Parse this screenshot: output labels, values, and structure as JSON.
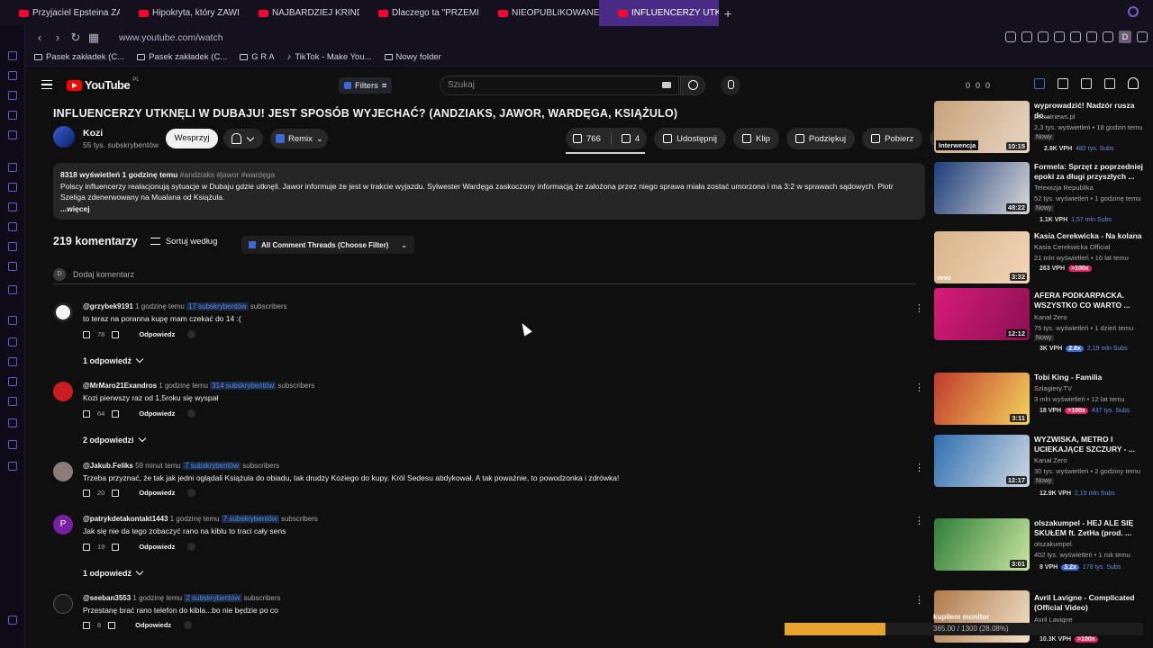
{
  "browser": {
    "tabs": [
      {
        "label": "Przyjaciel Epsteina ZATRZ"
      },
      {
        "label": "Hipokryta, który ZAWIÓD"
      },
      {
        "label": "NAJBARDZIEJ KRINDŻOW"
      },
      {
        "label": "Dlaczego ta \"PRZEMIŁA\""
      },
      {
        "label": "NIEOPUBLIKOWANE MATE"
      },
      {
        "label": "INFLUENCERZY UTKNĘLI"
      }
    ],
    "url": "www.youtube.com/watch",
    "bookmarks": [
      "Pasek zakładek (C...",
      "Pasek zakładek (C...",
      "G R A",
      "TikTok - Make You...",
      "Nowy folder"
    ],
    "profile_initial": "D"
  },
  "header": {
    "logo": "YouTube",
    "logo_country": "PL",
    "filters_label": "Filters",
    "search_placeholder": "Szukaj",
    "stats": [
      "0",
      "0",
      "0"
    ]
  },
  "video": {
    "title": "INFLUENCERZY UTKNĘLI W DUBAJU! JEST SPOSÓB WYJECHAĆ? (ANDZIAKS, JAWOR, WARDĘGA, KSIĄŻULO)",
    "channel": "Kozi",
    "subscribers": "55 tys. subskrybentów",
    "support_label": "Wesprzyj",
    "remix_label": "Remix",
    "likes": "766",
    "dislikes": "4",
    "share_label": "Udostępnij",
    "clip_label": "Klip",
    "thanks_label": "Podziękuj",
    "download_label": "Pobierz"
  },
  "description": {
    "meta": "8318 wyświetleń  1 godzinę temu",
    "tags": "#andziaks #jawor #wardęga",
    "text": "Polscy influencerzy realacjonują sytuacje w Dubaju gdzie utknęli. Jawor informuje że jest w trakcie wyjazdu. Sylwester Wardęga zaskoczony informacją że założona przez niego sprawa miała zostać umorzona i ma 3:2 w sprawach sądowych. Piotr Szeliga zdenerwowany na Mualana od Książula.",
    "more": "...więcej"
  },
  "comments_section": {
    "count": "219 komentarzy",
    "sort_label": "Sortuj według",
    "filter_label": "All Comment Threads (Choose Filter)",
    "add_avatar": "D",
    "add_placeholder": "Dodaj komentarz",
    "reply_label": "Odpowiedz",
    "comments": [
      {
        "author": "@grzybek9191",
        "time": "1 godzinę temu",
        "subs": "17 subskrybentów",
        "subs_suffix": "subscribers",
        "text": "to teraz na poranna kupę mam czekać do 14 :(",
        "likes": "78",
        "replies": "1 odpowiedź",
        "avatar_color": "#ffffff"
      },
      {
        "author": "@MrMaro21Exandros",
        "time": "1 godzinę temu",
        "subs": "314 subskrybentów",
        "subs_suffix": "subscribers",
        "text": "Kozi pierwszy raz od 1,5roku się wyspał",
        "likes": "64",
        "replies": "2 odpowiedzi",
        "avatar_color": "#c81e1e"
      },
      {
        "author": "@Jakub.Feliks",
        "time": "59 minut temu",
        "subs": "7 subskrybentów",
        "subs_suffix": "subscribers",
        "text": "Trzeba przyznać, że tak jak jedni oglądali Książula do obiadu, tak drudzy Koziego do kupy. Król Sedesu abdykował. A tak poważnie, to powodzonka i zdrówka!",
        "likes": "20",
        "replies": "",
        "avatar_color": "#8a7c78"
      },
      {
        "author": "@patrykdetakontakt1443",
        "time": "1 godzinę temu",
        "subs": "7 subskrybentów",
        "subs_suffix": "subscribers",
        "text": "Jak się nie da tego zobaczyć rano na kiblu to traci cały sens",
        "likes": "19",
        "replies": "1 odpowiedź",
        "avatar_color": "#7b1fa2",
        "avatar_letter": "P"
      },
      {
        "author": "@seeban3553",
        "time": "1 godzinę temu",
        "subs": "2 subskrybentów",
        "subs_suffix": "subscribers",
        "text": "Przestanę brać rano telefon do kibla...bo nie będzie po co",
        "likes": "8",
        "replies": "",
        "avatar_color": "#1a1a1a"
      }
    ]
  },
  "rail": [
    {
      "title": "wyprowadzić! Nadzór rusza do...",
      "channel": "polsatnews.pl",
      "meta": "2,3 tys. wyświetleń • 18 godzin temu",
      "new": "Nowy",
      "duration": "10:15",
      "label": "Interwencja",
      "vph": "2.9K VPH",
      "x": "",
      "subs": "482 tys. Subs",
      "c1": "#c9a27a",
      "c2": "#e7d6c3"
    },
    {
      "title": "Formela: Sprzęt z poprzedniej epoki za długi przyszłych ...",
      "channel": "Telewizja Republika",
      "meta": "52 tys. wyświetleń • 1 godzinę temu",
      "new": "Nowy",
      "duration": "48:22",
      "label": "",
      "vph": "1.1K VPH",
      "x": "",
      "subs": "1,57 mln Subs",
      "c1": "#1d3d7a",
      "c2": "#d9d9d9"
    },
    {
      "title": "Kasia Cerekwicka - Na kolana",
      "channel": "Kasia Cerekwicka Official",
      "meta": "21 mln wyświetleń • 16 lat temu",
      "new": "",
      "duration": "3:32",
      "label": "vevo",
      "vph": "263 VPH",
      "x": ">100x",
      "subs": "",
      "c1": "#d8b48a",
      "c2": "#f0d6b8"
    },
    {
      "title": "AFERA PODKARPACKA. WSZYSTKO CO WARTO ...",
      "channel": "Kanał Zero",
      "meta": "75 tys. wyświetleń • 1 dzień temu",
      "new": "Nowy",
      "duration": "12:12",
      "label": "",
      "vph": "3K VPH",
      "x": "2.8x",
      "subs": "2,19 mln Subs",
      "c1": "#d81b7a",
      "c2": "#8a1050"
    },
    {
      "title": "Tobi King - Familia",
      "channel": "Szlagiery.TV",
      "meta": "3 mln wyświetleń • 12 lat temu",
      "new": "",
      "duration": "3:11",
      "label": "",
      "vph": "18 VPH",
      "x": ">100x",
      "subs": "437 tys. Subs",
      "c1": "#c0392b",
      "c2": "#f4d35e"
    },
    {
      "title": "WYZWISKA, METRO I UCIEKAJĄCE SZCZURY - ...",
      "channel": "Kanał Zero",
      "meta": "30 tys. wyświetleń • 2 godziny temu",
      "new": "Nowy",
      "duration": "12:17",
      "label": "",
      "vph": "12.9K VPH",
      "x": "",
      "subs": "2,19 mln Subs",
      "c1": "#2e6fb0",
      "c2": "#cfd8e3"
    },
    {
      "title": "olszakumpel - HEJ ALE SIĘ SKUŁEM ft. ZetHa (prod. ...",
      "channel": "olszakumpel",
      "meta": "402 tys. wyświetleń • 1 rok temu",
      "new": "",
      "duration": "3:01",
      "label": "",
      "vph": "8 VPH",
      "x": "3.2x",
      "subs": "178 tys. Subs",
      "c1": "#2f7d3a",
      "c2": "#c8e6a0"
    },
    {
      "title": "Avril Lavigne - Complicated (Official Video)",
      "channel": "Avril Lavigne",
      "meta": "",
      "new": "",
      "duration": "",
      "label": "",
      "vph": "10.3K VPH",
      "x": ">100x",
      "subs": "",
      "c1": "#b07a4a",
      "c2": "#f1e0c8"
    }
  ],
  "progress": {
    "label": "kupiłem monitor",
    "text": "365.00 / 1300 (28.08%)",
    "fraction": 0.2808
  }
}
